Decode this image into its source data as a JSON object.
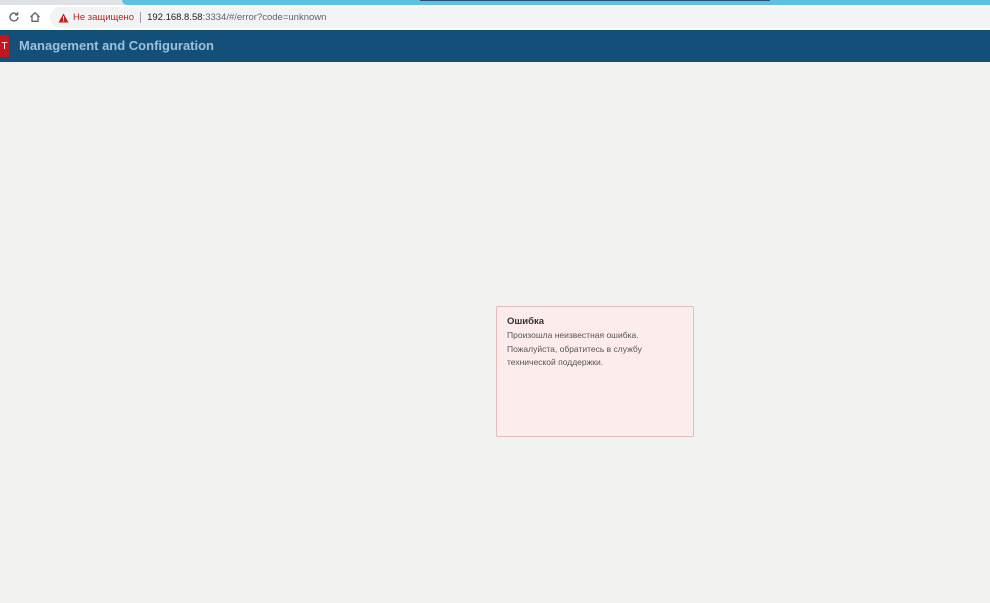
{
  "browser": {
    "not_secure_label": "Не защищено",
    "url_host": "192.168.8.58",
    "url_rest": ":3334/#/error?code=unknown"
  },
  "header": {
    "logo_letter": "T",
    "title": "Management and Configuration",
    "background_color": "#134f78",
    "logo_color": "#c4161c"
  },
  "error": {
    "title": "Ошибка",
    "message": "Произошла неизвестная ошибка. Пожалуйста, обратитесь в службу технической поддержки.",
    "background_color": "#fdecec"
  }
}
